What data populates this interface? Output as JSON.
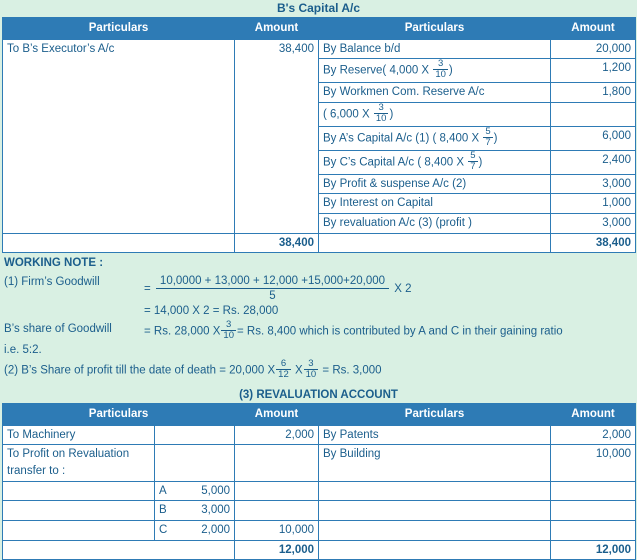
{
  "capital_account": {
    "title": "B's Capital A/c",
    "headers": [
      "Particulars",
      "Amount",
      "Particulars",
      "Amount"
    ],
    "left_rows": [
      {
        "particulars": "To B’s Executor’s A/c",
        "amount": "38,400"
      }
    ],
    "right_rows": [
      {
        "particulars": "By Balance b/d",
        "amount": "20,000"
      },
      {
        "particulars": "By Reserve( 4,000 X ",
        "frac_n": "3",
        "frac_d": "10",
        "suffix": ")",
        "amount": "1,200"
      },
      {
        "particulars": "By Workmen Com. Reserve A/c",
        "amount": "1,800"
      },
      {
        "particulars": "( 6,000 X ",
        "frac_n": "3",
        "frac_d": "10",
        "suffix": ")",
        "amount": ""
      },
      {
        "particulars": "By A’s Capital A/c (1) ( 8,400 X ",
        "frac_n": "5",
        "frac_d": "7",
        "suffix": ")",
        "amount": "6,000"
      },
      {
        "particulars": "By C’s Capital A/c ( 8,400 X ",
        "frac_n": "5",
        "frac_d": "7",
        "suffix": ")",
        "amount": "2,400"
      },
      {
        "particulars": "By Profit & suspense A/c (2)",
        "amount": "3,000"
      },
      {
        "particulars": "By Interest on Capital",
        "amount": "1,000"
      },
      {
        "particulars": "By revaluation A/c (3) (profit )",
        "amount": "3,000"
      }
    ],
    "total_left": "38,400",
    "total_right": "38,400"
  },
  "working_note": {
    "heading": "WORKING NOTE :",
    "line1_label": "(1) Firm’s Goodwill",
    "line1_eq": "=",
    "line1_num": "10,0000 + 13,000 + 12,000 +15,000+20,000",
    "line1_den": "5",
    "line1_tail": "X 2",
    "line2": "= 14,000  X 2 = Rs. 28,000",
    "line3_label": "B’s share of Goodwill",
    "line3_eq": "=",
    "line3_a": "Rs.  28,000 X",
    "line3_frac_n": "3",
    "line3_frac_d": "10",
    "line3_b": "= Rs. 8,400 which is contributed by A and C in their gaining ratio",
    "line4": "i.e. 5:2.",
    "line5_a": "(2) B’s Share of profit till the date of death = 20,000 X",
    "line5_f1n": "6",
    "line5_f1d": "12",
    "line5_x": "X",
    "line5_f2n": "3",
    "line5_f2d": "10",
    "line5_b": "= Rs. 3,000"
  },
  "revaluation": {
    "title": "(3) REVALUATION ACCOUNT",
    "headers": [
      "Particulars",
      "Amount",
      "Particulars",
      "Amount"
    ],
    "left_rows": [
      {
        "particulars": "To Machinery",
        "sub": "",
        "subamount": "",
        "amount": "2,000"
      },
      {
        "particulars": "To Profit on Revaluation transfer to :",
        "sub": "",
        "subamount": "",
        "amount": ""
      },
      {
        "particulars": "",
        "sub": "A",
        "subamount": "5,000",
        "amount": ""
      },
      {
        "particulars": "",
        "sub": "B",
        "subamount": "3,000",
        "amount": ""
      },
      {
        "particulars": "",
        "sub": "C",
        "subamount": "2,000",
        "amount": "10,000"
      }
    ],
    "right_rows": [
      {
        "particulars": "By Patents",
        "amount": "2,000"
      },
      {
        "particulars": "By Building",
        "amount": "10,000"
      },
      {
        "particulars": "",
        "amount": ""
      },
      {
        "particulars": "",
        "amount": ""
      },
      {
        "particulars": "",
        "amount": ""
      }
    ],
    "total_left": "12,000",
    "total_right": "12,000"
  }
}
